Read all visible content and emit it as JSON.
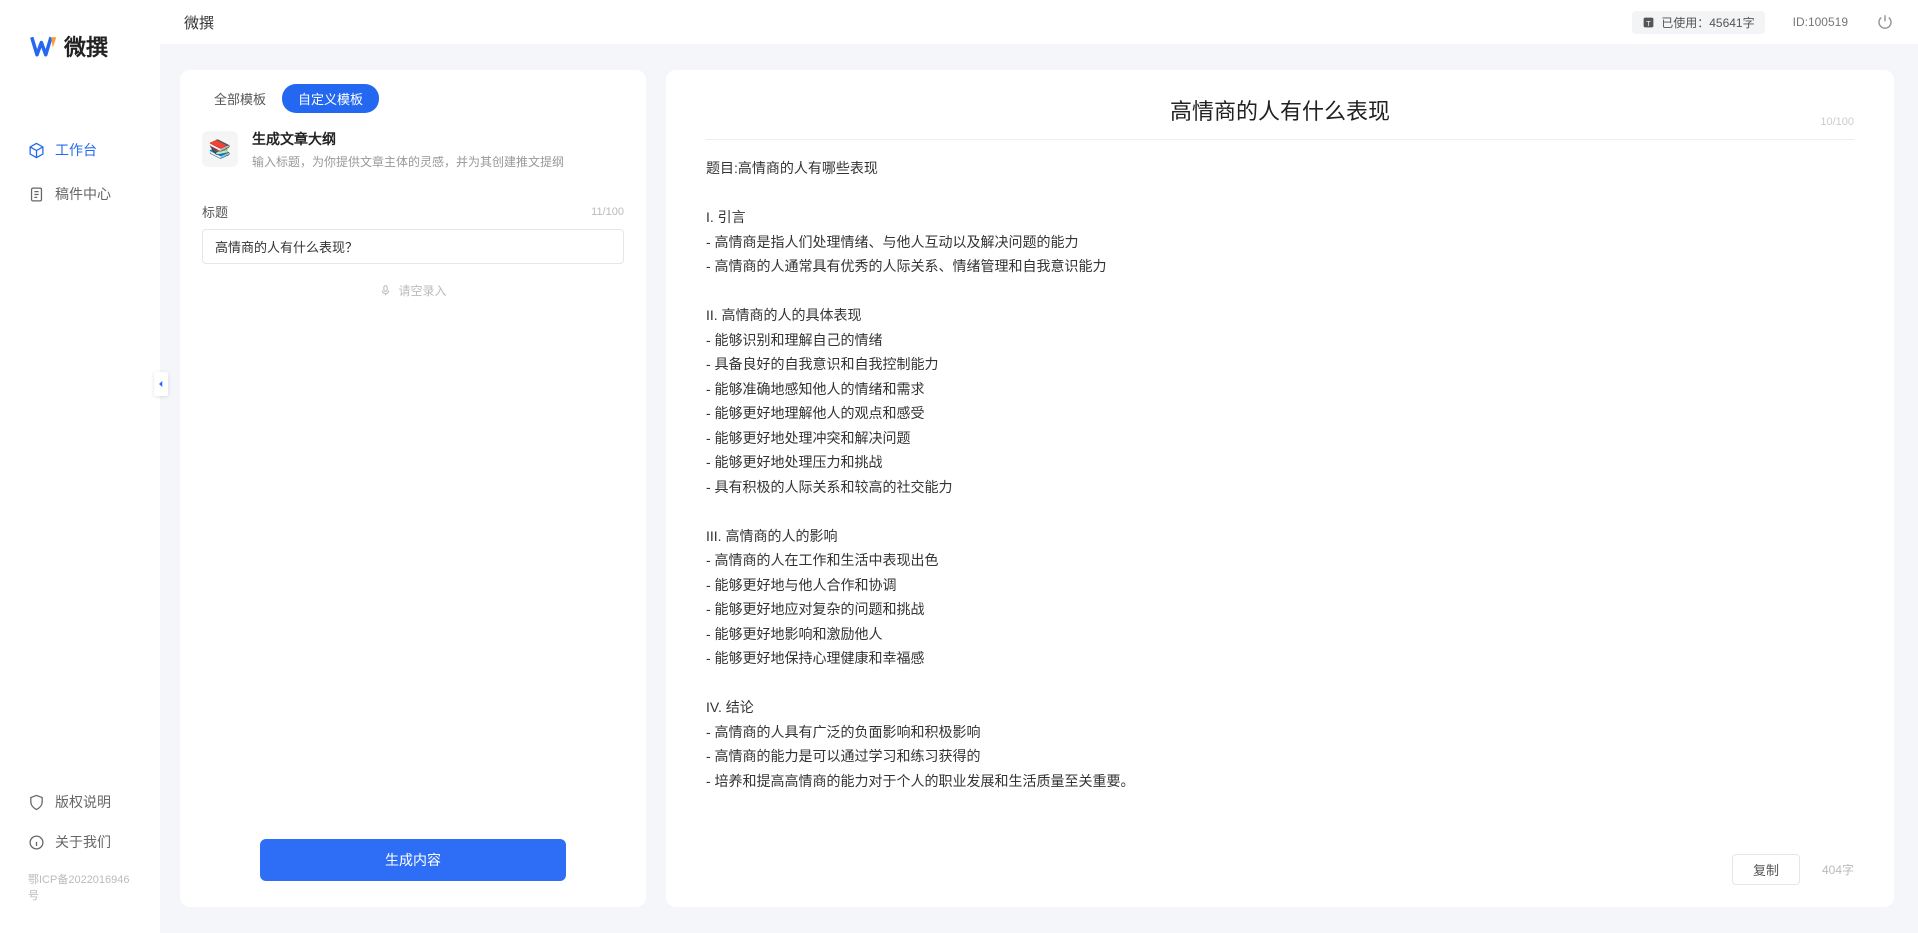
{
  "brand": {
    "name": "微撰"
  },
  "sidebar": {
    "nav": [
      {
        "label": "工作台",
        "icon": "cube-icon",
        "active": true
      },
      {
        "label": "稿件中心",
        "icon": "doc-icon",
        "active": false
      }
    ],
    "bottom": [
      {
        "label": "版权说明",
        "icon": "shield-icon"
      },
      {
        "label": "关于我们",
        "icon": "info-icon"
      }
    ],
    "icp": "鄂ICP备2022016946号"
  },
  "topbar": {
    "title": "微撰",
    "usage_label": "已使用：",
    "usage_value": "45641字",
    "user_id": "ID:100519"
  },
  "left": {
    "tabs": [
      {
        "label": "全部模板",
        "active": false
      },
      {
        "label": "自定义模板",
        "active": true
      }
    ],
    "template": {
      "name": "生成文章大纲",
      "desc": "输入标题，为你提供文章主体的灵感，并为其创建推文提纲"
    },
    "field_label": "标题",
    "field_counter": "11/100",
    "title_value": "高情商的人有什么表现？",
    "voice_label": "请空录入",
    "generate_label": "生成内容"
  },
  "right": {
    "title": "高情商的人有什么表现",
    "title_counter": "10/100",
    "body": "题目:高情商的人有哪些表现\n\nI. 引言\n- 高情商是指人们处理情绪、与他人互动以及解决问题的能力\n- 高情商的人通常具有优秀的人际关系、情绪管理和自我意识能力\n\nII. 高情商的人的具体表现\n- 能够识别和理解自己的情绪\n- 具备良好的自我意识和自我控制能力\n- 能够准确地感知他人的情绪和需求\n- 能够更好地理解他人的观点和感受\n- 能够更好地处理冲突和解决问题\n- 能够更好地处理压力和挑战\n- 具有积极的人际关系和较高的社交能力\n\nIII. 高情商的人的影响\n- 高情商的人在工作和生活中表现出色\n- 能够更好地与他人合作和协调\n- 能够更好地应对复杂的问题和挑战\n- 能够更好地影响和激励他人\n- 能够更好地保持心理健康和幸福感\n\nIV. 结论\n- 高情商的人具有广泛的负面影响和积极影响\n- 高情商的能力是可以通过学习和练习获得的\n- 培养和提高高情商的能力对于个人的职业发展和生活质量至关重要。",
    "copy_label": "复制",
    "word_count": "404字"
  }
}
